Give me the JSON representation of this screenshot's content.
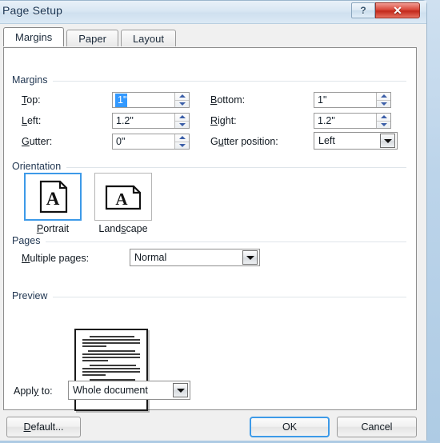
{
  "window": {
    "title": "Page Setup",
    "help_button": "?",
    "close_button": "✕"
  },
  "tabs": [
    {
      "label": "Margins",
      "active": true
    },
    {
      "label": "Paper",
      "active": false
    },
    {
      "label": "Layout",
      "active": false
    }
  ],
  "margins": {
    "group_label": "Margins",
    "top": {
      "label": "Top:",
      "value": "1\"",
      "selected": true
    },
    "bottom": {
      "label": "Bottom:",
      "value": "1\""
    },
    "left": {
      "label": "Left:",
      "value": "1.2\""
    },
    "right": {
      "label": "Right:",
      "value": "1.2\""
    },
    "gutter": {
      "label": "Gutter:",
      "value": "0\""
    },
    "gutter_position": {
      "label": "Gutter position:",
      "value": "Left"
    }
  },
  "orientation": {
    "group_label": "Orientation",
    "portrait": {
      "label": "Portrait",
      "selected": true,
      "icon": "page-portrait-icon"
    },
    "landscape": {
      "label": "Landscape",
      "selected": false,
      "icon": "page-landscape-icon"
    }
  },
  "pages": {
    "group_label": "Pages",
    "multiple_pages": {
      "label": "Multiple pages:",
      "value": "Normal"
    }
  },
  "preview": {
    "group_label": "Preview"
  },
  "apply": {
    "label": "Apply to:",
    "value": "Whole document"
  },
  "buttons": {
    "default": "Default...",
    "ok": "OK",
    "cancel": "Cancel"
  },
  "colors": {
    "accent": "#3d9ae8",
    "selection": "#3399ff",
    "close": "#c1291b",
    "title_text": "#16314f"
  }
}
